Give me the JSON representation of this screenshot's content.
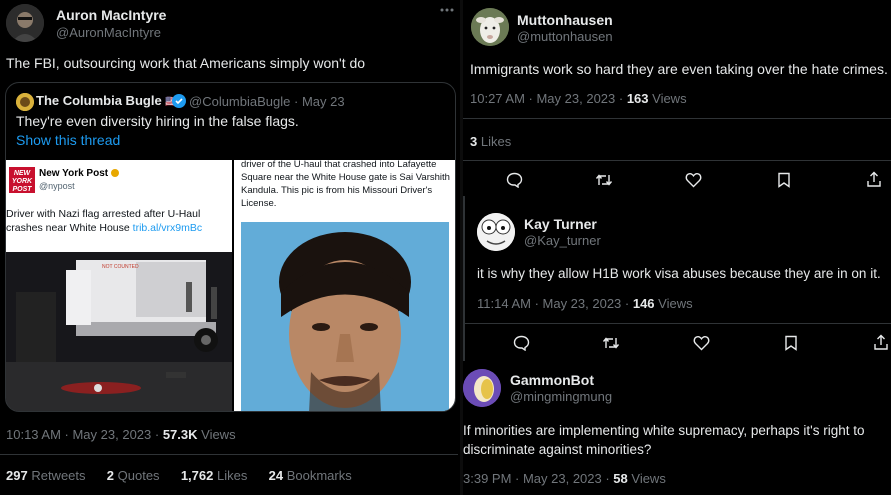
{
  "left_tweet": {
    "author_name": "Auron MacIntyre",
    "author_handle": "@AuronMacIntyre",
    "text": "The FBI, outsourcing work that Americans simply won't do",
    "more_icon": "more-dots-icon",
    "quote": {
      "author_name": "The Columbia Bugle",
      "flag": "🇺🇸",
      "author_handle": "@ColumbiaBugle",
      "date": "May 23",
      "text": "They're even diversity hiring in the false flags.",
      "show_thread": "Show this thread",
      "left_image": {
        "source_name": "New York Post",
        "source_handle": "@nypost",
        "logo_text": "NEW YORK POST",
        "headline": "Driver with Nazi flag arrested after U-Haul crashes near White House",
        "link": "trib.al/vrx9mBc",
        "truck_text": "NOT COUNTED"
      },
      "right_image": {
        "caption": "driver of the U-haul that crashed into Lafayette Square near the White House gate is Sai Varshith Kandula. This pic is from his Missouri Driver's License."
      }
    },
    "time": "10:13 AM · May 23, 2023 · ",
    "views_count": "57.3K",
    "views_label": " Views",
    "stats": {
      "retweets_count": "297",
      "retweets_label": "Retweets",
      "quotes_count": "2",
      "quotes_label": "Quotes",
      "likes_count": "1,762",
      "likes_label": "Likes",
      "bookmarks_count": "24",
      "bookmarks_label": "Bookmarks"
    }
  },
  "right_tweets": [
    {
      "author_name": "Muttonhausen",
      "author_handle": "@muttonhausen",
      "text": "Immigrants work so hard they are even taking over the hate crimes.",
      "time": "10:27 AM · May 23, 2023 · ",
      "views_count": "163",
      "views_label": " Views",
      "likes_count": "3",
      "likes_label": " Likes"
    },
    {
      "author_name": "Kay Turner",
      "author_handle": "@Kay_turner",
      "text": "it is why they allow H1B work visa abuses because they are in on it.",
      "time": "11:14 AM · May 23, 2023 · ",
      "views_count": "146",
      "views_label": " Views"
    },
    {
      "author_name": "GammonBot",
      "author_handle": "@mingmingmung",
      "text": "If minorities are implementing white supremacy, perhaps it's right to discriminate against minorities?",
      "time": "3:39 PM · May 23, 2023 · ",
      "views_count": "58",
      "views_label": " Views"
    }
  ],
  "action_icons": [
    "reply-icon",
    "retweet-icon",
    "like-icon",
    "bookmark-icon",
    "share-icon"
  ],
  "colors": {
    "background": "#000000",
    "text": "#e7e9ea",
    "muted": "#71767b",
    "link": "#1d9bf0",
    "divider": "#2f3336"
  }
}
